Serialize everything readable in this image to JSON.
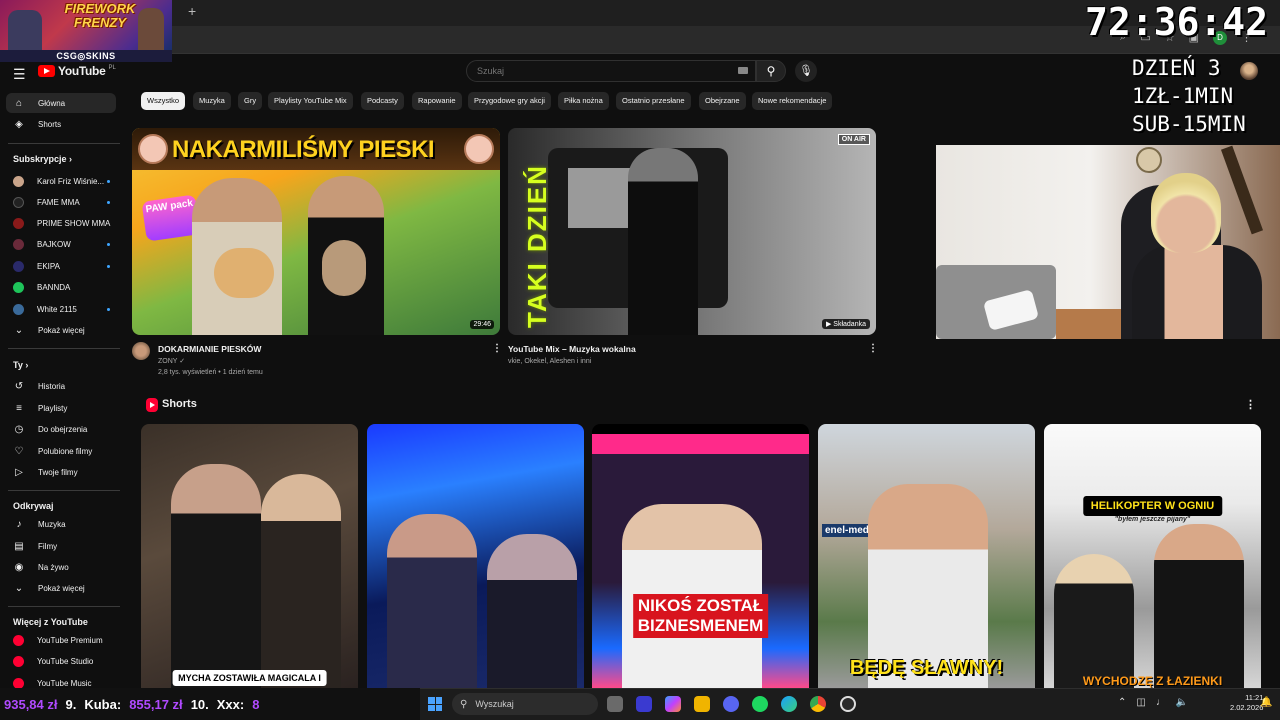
{
  "overlay": {
    "game_title": "FIREWORK FRENZY",
    "sponsor": "CSG◎SKINS",
    "timer": "72:36:42",
    "day_lines": [
      "DZIEŃ 3",
      "1ZŁ-1MIN",
      "SUB-15MIN"
    ]
  },
  "browser": {
    "new_tab": "+"
  },
  "header": {
    "logo": "YouTube",
    "region": "PL",
    "search_placeholder": "Szukaj"
  },
  "sidebar": {
    "main": [
      {
        "label": "Główna",
        "icon": "home-icon",
        "glyph": "⌂"
      },
      {
        "label": "Shorts",
        "icon": "shorts-icon",
        "glyph": "◈"
      }
    ],
    "subs_heading": "Subskrypcje",
    "subs": [
      {
        "label": "Karol Friz Wiśnie...",
        "color": "#c9a48a"
      },
      {
        "label": "FAME MMA",
        "color": "#222222"
      },
      {
        "label": "PRIME SHOW MMA",
        "color": "#8a1a1a"
      },
      {
        "label": "BAJKOW",
        "color": "#6a2a3a"
      },
      {
        "label": "EKIPA",
        "color": "#2a2a6a"
      },
      {
        "label": "BANNDA",
        "color": "#1ec45a"
      },
      {
        "label": "White 2115",
        "color": "#3a6a9a"
      },
      {
        "label": "Pokaż więcej",
        "glyph": "⌄"
      }
    ],
    "you_heading": "Ty",
    "you": [
      {
        "label": "Historia",
        "icon": "history-icon",
        "glyph": "↺"
      },
      {
        "label": "Playlisty",
        "icon": "playlist-icon",
        "glyph": "≡"
      },
      {
        "label": "Do obejrzenia",
        "icon": "watch-later-icon",
        "glyph": "◷"
      },
      {
        "label": "Polubione filmy",
        "icon": "thumbs-up-icon",
        "glyph": "👍"
      },
      {
        "label": "Twoje filmy",
        "icon": "your-videos-icon",
        "glyph": "▷"
      }
    ],
    "explore_heading": "Odkrywaj",
    "explore": [
      {
        "label": "Muzyka",
        "icon": "music-icon",
        "glyph": "♪"
      },
      {
        "label": "Filmy",
        "icon": "film-icon",
        "glyph": "▤"
      },
      {
        "label": "Na żywo",
        "icon": "live-icon",
        "glyph": "◉"
      },
      {
        "label": "Pokaż więcej",
        "icon": "chevron-down-icon",
        "glyph": "⌄"
      }
    ],
    "more_heading": "Więcej z YouTube",
    "more": [
      {
        "label": "YouTube Premium",
        "color": "#ff0033"
      },
      {
        "label": "YouTube Studio",
        "color": "#ff0033"
      },
      {
        "label": "YouTube Music",
        "color": "#ff0033"
      }
    ]
  },
  "chips": [
    "Wszystko",
    "Muzyka",
    "Gry",
    "Playlisty YouTube Mix",
    "Podcasty",
    "Rapowanie",
    "Przygodowe gry akcji",
    "Piłka nożna",
    "Ostatnio przesłane",
    "Obejrzane",
    "Nowe rekomendacje"
  ],
  "videos": [
    {
      "thumb_text": "NAKARMILIŚMY PIESKI",
      "pack_text": "PAW pack",
      "duration": "29:46",
      "title": "DOKARMIANIE PIESKÓW",
      "channel": "ZONY",
      "meta": "2,8 tys. wyświetleń • 1 dzień temu"
    },
    {
      "graffiti": "TAKI DZIEŃ",
      "on_air": "ON AIR",
      "badge": "Składanka",
      "title": "YouTube Mix – Muzyka wokalna",
      "meta": "vkie, Okekel, Aleshen i inni"
    }
  ],
  "shorts": {
    "title": "Shorts",
    "items": [
      {
        "caption": "MYCHA ZOSTAWIŁA MAGICALA I"
      },
      {
        "caption": ""
      },
      {
        "caption_lines": [
          "NIKOŚ ZOSTAŁ",
          "BIZNESMENEM"
        ]
      },
      {
        "caption": "BĘDĘ SŁAWNY!",
        "sign": "enel-med"
      },
      {
        "caption": "HELIKOPTER W OGNIU",
        "sub": "\"byłem jeszcze pijany\"",
        "bottom": "WYCHODZĘ Z ŁAZIENKI"
      }
    ]
  },
  "taskbar": {
    "ticker": [
      {
        "amount": "935,84 zł"
      },
      {
        "rank": "9.",
        "name": "Kuba:",
        "amount": "855,17 zł"
      },
      {
        "rank": "10.",
        "name": "Xxx:",
        "amount": "8"
      }
    ],
    "search": "Wyszukaj",
    "time": "11:21",
    "date": "2.02.2026"
  }
}
